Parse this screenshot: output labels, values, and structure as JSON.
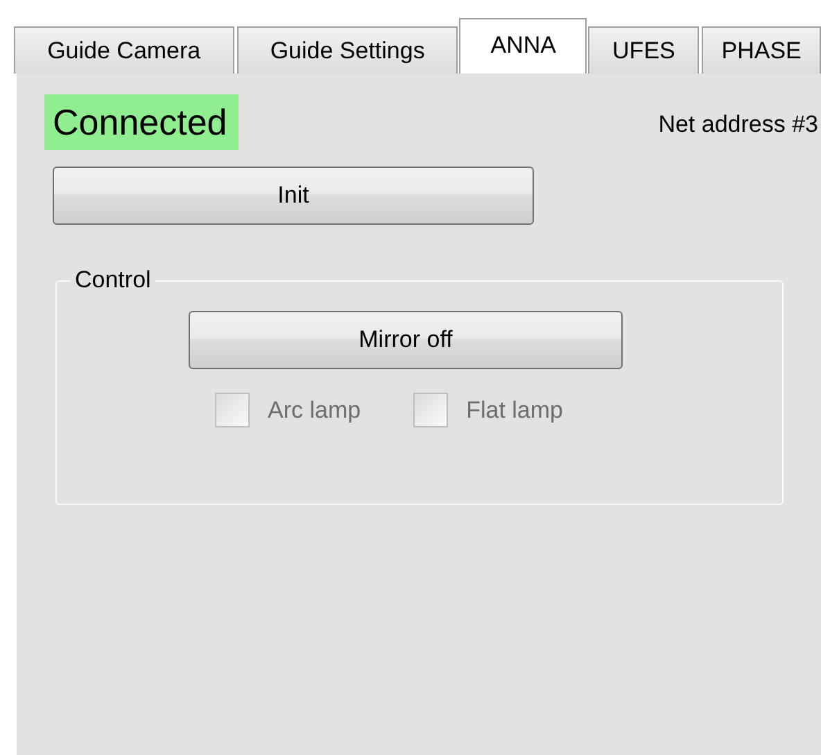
{
  "tabs": [
    {
      "label": "Guide Camera",
      "selected": false
    },
    {
      "label": "Guide Settings",
      "selected": false
    },
    {
      "label": "ANNA",
      "selected": true
    },
    {
      "label": "UFES",
      "selected": false
    },
    {
      "label": "PHASE",
      "selected": false
    }
  ],
  "status": {
    "text": "Connected",
    "connected": true
  },
  "net_address": "Net address #3",
  "init_button": "Init",
  "control_group": {
    "title": "Control",
    "button": "Mirror off",
    "checkboxes": [
      {
        "label": "Arc lamp",
        "checked": false,
        "disabled": true
      },
      {
        "label": "Flat lamp",
        "checked": false,
        "disabled": true
      }
    ]
  }
}
